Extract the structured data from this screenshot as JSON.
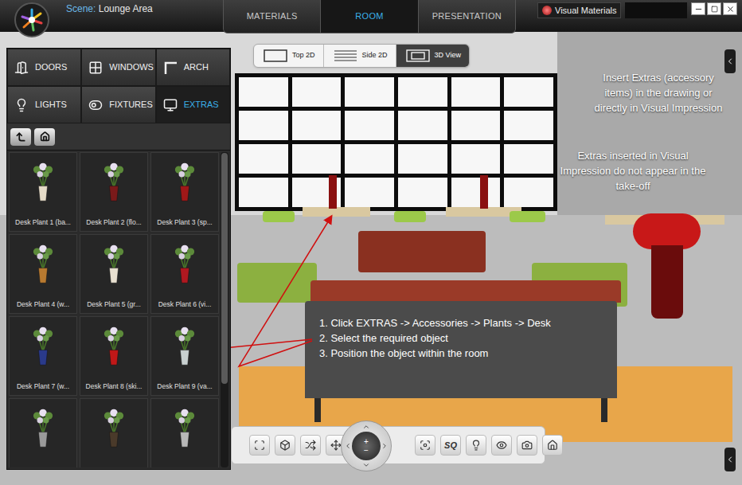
{
  "window": {
    "scene_label": "Scene:",
    "scene_name": "Lounge Area",
    "button": "Visual Materials"
  },
  "tabs": [
    {
      "label": "MATERIALS",
      "selected": false
    },
    {
      "label": "ROOM",
      "selected": true
    },
    {
      "label": "PRESENTATION",
      "selected": false
    }
  ],
  "view_modes": [
    {
      "label": "Top 2D",
      "selected": false
    },
    {
      "label": "Side 2D",
      "selected": false
    },
    {
      "label": "3D View",
      "selected": true
    }
  ],
  "categories": [
    {
      "label": "DOORS",
      "selected": false
    },
    {
      "label": "WINDOWS",
      "selected": false
    },
    {
      "label": "ARCH",
      "selected": false
    },
    {
      "label": "LIGHTS",
      "selected": false
    },
    {
      "label": "FIXTURES",
      "selected": false
    },
    {
      "label": "EXTRAS",
      "selected": true
    }
  ],
  "items": [
    {
      "label": "Desk Plant 1 (ba...",
      "color": "#e6dcc8"
    },
    {
      "label": "Desk Plant 2 (flo...",
      "color": "#7a1a1a"
    },
    {
      "label": "Desk Plant 3 (sp...",
      "color": "#a01818"
    },
    {
      "label": "Desk Plant 4 (w...",
      "color": "#b87a30"
    },
    {
      "label": "Desk Plant 5 (gr...",
      "color": "#e8e0d0"
    },
    {
      "label": "Desk Plant 6 (vi...",
      "color": "#b01820"
    },
    {
      "label": "Desk Plant 7 (w...",
      "color": "#2a3a8a"
    },
    {
      "label": "Desk Plant 8 (ski...",
      "color": "#c01818"
    },
    {
      "label": "Desk Plant 9 (va...",
      "color": "#c8d0d0"
    }
  ],
  "partial_items": [
    {
      "color": "#9a9a9a"
    },
    {
      "color": "#4a3a2a"
    },
    {
      "color": "#b8b8b8"
    }
  ],
  "notes": [
    "Insert Extras (accessory items) in the drawing or directly in Visual Impression",
    "Extras inserted in Visual Impression do not appear in the take-off"
  ],
  "steps": [
    "1. Click EXTRAS -> Accessories -> Plants -> Desk",
    "2. Select the required object",
    "3. Position the object within the room"
  ],
  "toolbar": {
    "sq": "SQ",
    "zoom_in": "+",
    "zoom_out": "−"
  }
}
